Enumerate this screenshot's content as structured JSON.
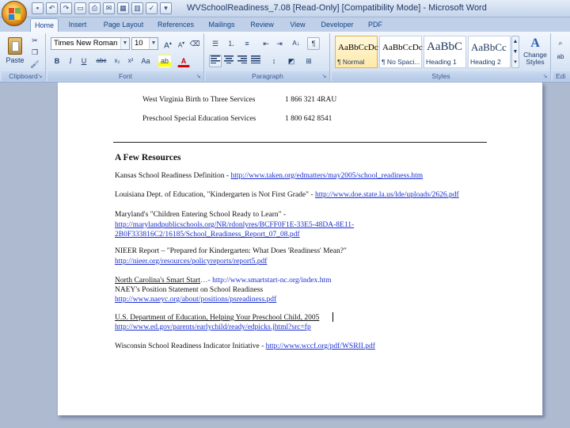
{
  "window": {
    "title": "WVSchoolReadiness_7.08 [Read-Only] [Compatibility Mode] - Microsoft Word"
  },
  "quick_access": [
    "save-icon",
    "undo-icon",
    "redo-icon",
    "open-icon",
    "print-icon",
    "email-icon",
    "table-icon",
    "chart-icon",
    "spell-icon",
    "customize-icon"
  ],
  "tabs": [
    "Home",
    "Insert",
    "Page Layout",
    "References",
    "Mailings",
    "Review",
    "View",
    "Developer",
    "PDF"
  ],
  "ribbon": {
    "clipboard": {
      "paste_label": "Paste",
      "group_label": "Clipboard"
    },
    "font": {
      "font_name": "Times New Roman",
      "font_size": "10",
      "group_label": "Font"
    },
    "paragraph": {
      "group_label": "Paragraph"
    },
    "styles": {
      "group_label": "Styles",
      "items": [
        {
          "sample": "AaBbCcDc",
          "name": "¶ Normal"
        },
        {
          "sample": "AaBbCcDc",
          "name": "¶ No Spaci..."
        },
        {
          "sample": "AaBbC",
          "name": "Heading 1"
        },
        {
          "sample": "AaBbCc",
          "name": "Heading 2"
        }
      ],
      "change_label": "Change Styles"
    },
    "editing": {
      "group_label": "Edi"
    }
  },
  "document": {
    "contacts": [
      {
        "name": "West Virginia  Birth to Three Services",
        "phone": "1 866 321 4RAU"
      },
      {
        "name": "Preschool Special Education Services",
        "phone": "1 800 642 8541"
      }
    ],
    "heading": "A Few Resources",
    "resources": [
      {
        "text": "Kansas School Readiness Definition - ",
        "link1": "http://www.taken.org/edmatters/may2005/school_readiness.htm"
      },
      {
        "text": "Louisiana Dept. of Education, \"Kindergarten is Not First Grade\" - ",
        "link1": "http://www.doe.state.la.us/lde/uploads/2626.pdf"
      },
      {
        "text": "Maryland's \"Children Entering School Ready to Learn\" -",
        "link1": "http://marylandpublicschools.org/NR/rdonlyres/BCFF0F1E-33E5-48DA-8E11-",
        "link2": "2B0F333816C2/16185/School_Readiness_Report_07_08.pdf"
      },
      {
        "text": "NIEER Report – \"Prepared for Kindergarten: What Does 'Readiness' Mean?\"",
        "link1": "http://nieer.org/resources/policyreports/report5.pdf"
      },
      {
        "text": "North Carolina's Smart Start",
        "link1": "- http://www.smartstart-nc.org/index.htm",
        "text2": "NAEY's Position Statement on School Readiness",
        "link2": "http://www.naeyc.org/about/positions/psreadiness.pdf"
      },
      {
        "text": "U.S. Department of Education, Helping Your Preschool Child, 2005",
        "link1": "http://www.ed.gov/parents/earlychild/ready/edpicks.jhtml?src=fp"
      },
      {
        "text": "Wisconsin School Readiness Indicator Initiative - ",
        "link1": "http://www.wccf.org/pdf/WSRII.pdf"
      }
    ]
  }
}
